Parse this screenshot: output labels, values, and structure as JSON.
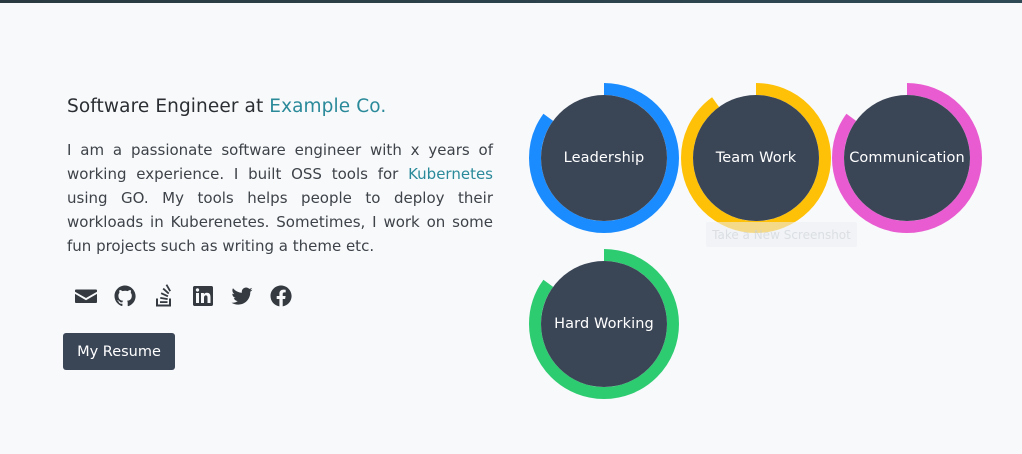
{
  "about": {
    "headline_prefix": "Software Engineer at ",
    "company": "Example Co.",
    "summary_part1": "I am a passionate software engineer with x years of working experience. I built OSS tools for ",
    "summary_link": "Kubernetes",
    "summary_part2": " using GO. My tools helps people to deploy their workloads in Kuberenetes. Sometimes, I work on some fun projects such as writing a theme etc."
  },
  "socials": [
    {
      "icon": "envelope-icon"
    },
    {
      "icon": "github-icon"
    },
    {
      "icon": "stackoverflow-icon"
    },
    {
      "icon": "linkedin-icon"
    },
    {
      "icon": "twitter-icon"
    },
    {
      "icon": "facebook-icon"
    }
  ],
  "resume_button": "My Resume",
  "skills": [
    {
      "label": "Leadership",
      "color": "#1a8cff",
      "percent": 85
    },
    {
      "label": "Team Work",
      "color": "#ffc107",
      "percent": 90
    },
    {
      "label": "Communication",
      "color": "#e95bd0",
      "percent": 85
    },
    {
      "label": "Hard Working",
      "color": "#2ecc71",
      "percent": 85
    }
  ],
  "tooltip": "Take a New Screenshot",
  "colors": {
    "accent": "#2a8a9a",
    "dark": "#3a4556",
    "background": "#f8f9fb"
  }
}
